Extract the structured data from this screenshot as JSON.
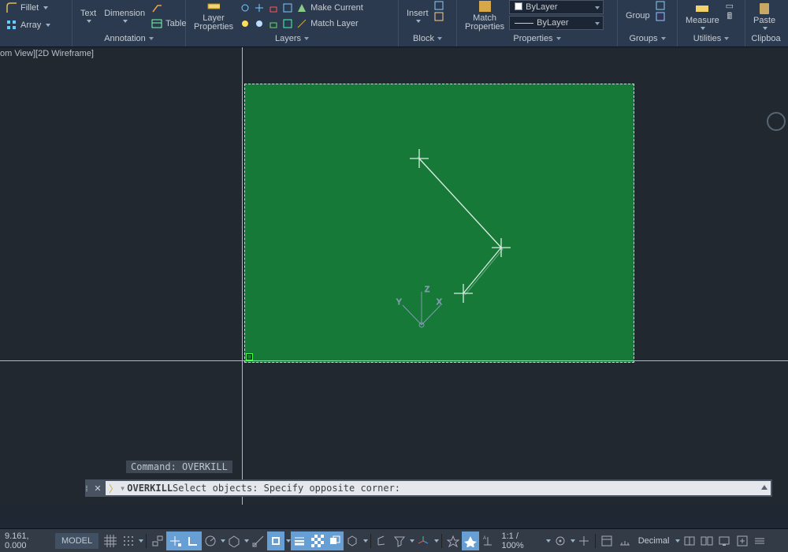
{
  "ribbon": {
    "modify": {
      "fillet": "Fillet",
      "array": "Array"
    },
    "annotation": {
      "title": "Annotation",
      "text": "Text",
      "dimension": "Dimension",
      "table": "Table"
    },
    "layers": {
      "title": "Layers",
      "layer_properties": "Layer\nProperties",
      "make_current": "Make Current",
      "match_layer": "Match Layer"
    },
    "block": {
      "title": "Block",
      "insert": "Insert"
    },
    "properties": {
      "title": "Properties",
      "match": "Match\nProperties",
      "bylayer1": "ByLayer",
      "bylayer2": "ByLayer"
    },
    "groups": {
      "title": "Groups",
      "group": "Group"
    },
    "utilities": {
      "title": "Utilities",
      "measure": "Measure"
    },
    "clipboard": {
      "title": "Clipboa",
      "paste": "Paste"
    }
  },
  "view": {
    "stamp": "om View][2D Wireframe]"
  },
  "command": {
    "history": "Command: OVERKILL",
    "active_cmd": "OVERKILL",
    "prompt_tail": " Select objects: Specify opposite corner:"
  },
  "status": {
    "coords": "9.161, 0.000",
    "model": "MODEL",
    "scale": "1:1 / 100%",
    "units": "Decimal"
  }
}
